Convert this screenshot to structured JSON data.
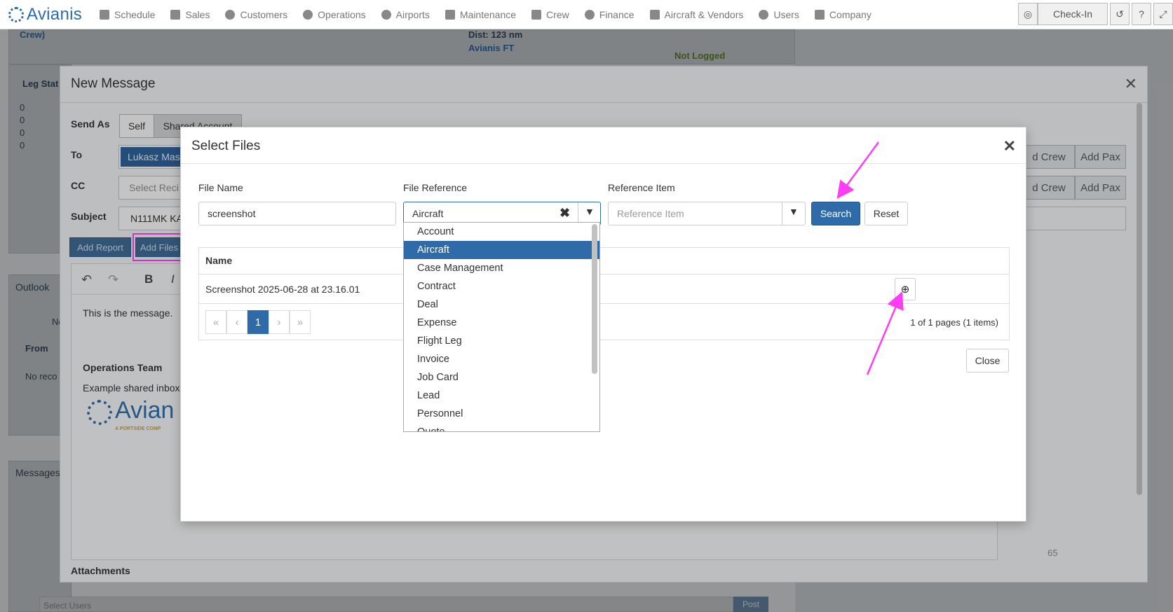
{
  "nav": {
    "brand": "Avianis",
    "items": [
      "Schedule",
      "Sales",
      "Customers",
      "Operations",
      "Airports",
      "Maintenance",
      "Crew",
      "Finance",
      "Aircraft & Vendors",
      "Users",
      "Company"
    ],
    "checkin": "Check-In"
  },
  "background": {
    "crew_link": "Crew)",
    "dist": "Dist: 123 nm",
    "avianis_ft": "Avianis FT",
    "not_logged": "Not Logged",
    "leg_status": "Leg Stat",
    "counts": [
      "0",
      "0",
      "0",
      "0"
    ],
    "outlook": "Outlook",
    "from": "From",
    "no_records": "No reco",
    "messages": "Messages",
    "select_users": "Select Users",
    "post": "Post",
    "new_short": "Ne"
  },
  "new_message": {
    "title": "New Message",
    "send_as_label": "Send As",
    "send_as_self": "Self",
    "send_as_shared": "Shared Account",
    "to_label": "To",
    "to_chip": "Lukasz Mas",
    "cc_label": "CC",
    "cc_placeholder": "Select Reci",
    "subject_label": "Subject",
    "subject_value": "N111MK KA",
    "add_report": "Add Report",
    "add_files": "Add Files",
    "add_crew": "d Crew",
    "add_pax": "Add Pax",
    "add_crew_2": "d Crew",
    "add_pax_2": "Add Pax",
    "body_line1": "This is the message.",
    "signature_title": "Operations Team",
    "signature_line": "Example shared inbox",
    "signature_logo": "Avian",
    "signature_tagline": "A PORTSIDE COMP",
    "char_count": "65",
    "attachments_label": "Attachments"
  },
  "select_files": {
    "title": "Select Files",
    "file_name_label": "File Name",
    "file_name_value": "screenshot",
    "file_reference_label": "File Reference",
    "file_reference_value": "Aircraft",
    "reference_item_label": "Reference Item",
    "reference_item_placeholder": "Reference Item",
    "search": "Search",
    "reset": "Reset",
    "table_header_name": "Name",
    "rows": [
      {
        "name": "Screenshot 2025-06-28 at 23.16.01"
      }
    ],
    "current_page": "1",
    "pager_info": "1 of 1 pages (1 items)",
    "close": "Close",
    "dropdown_options": [
      "Account",
      "Aircraft",
      "Case Management",
      "Contract",
      "Deal",
      "Expense",
      "Flight Leg",
      "Invoice",
      "Job Card",
      "Lead",
      "Personnel",
      "Quote"
    ],
    "dropdown_selected": "Aircraft"
  },
  "colors": {
    "brand_blue": "#2e6ba8",
    "highlight_magenta": "#ff3df5",
    "not_logged_green": "#5a8a1e"
  }
}
